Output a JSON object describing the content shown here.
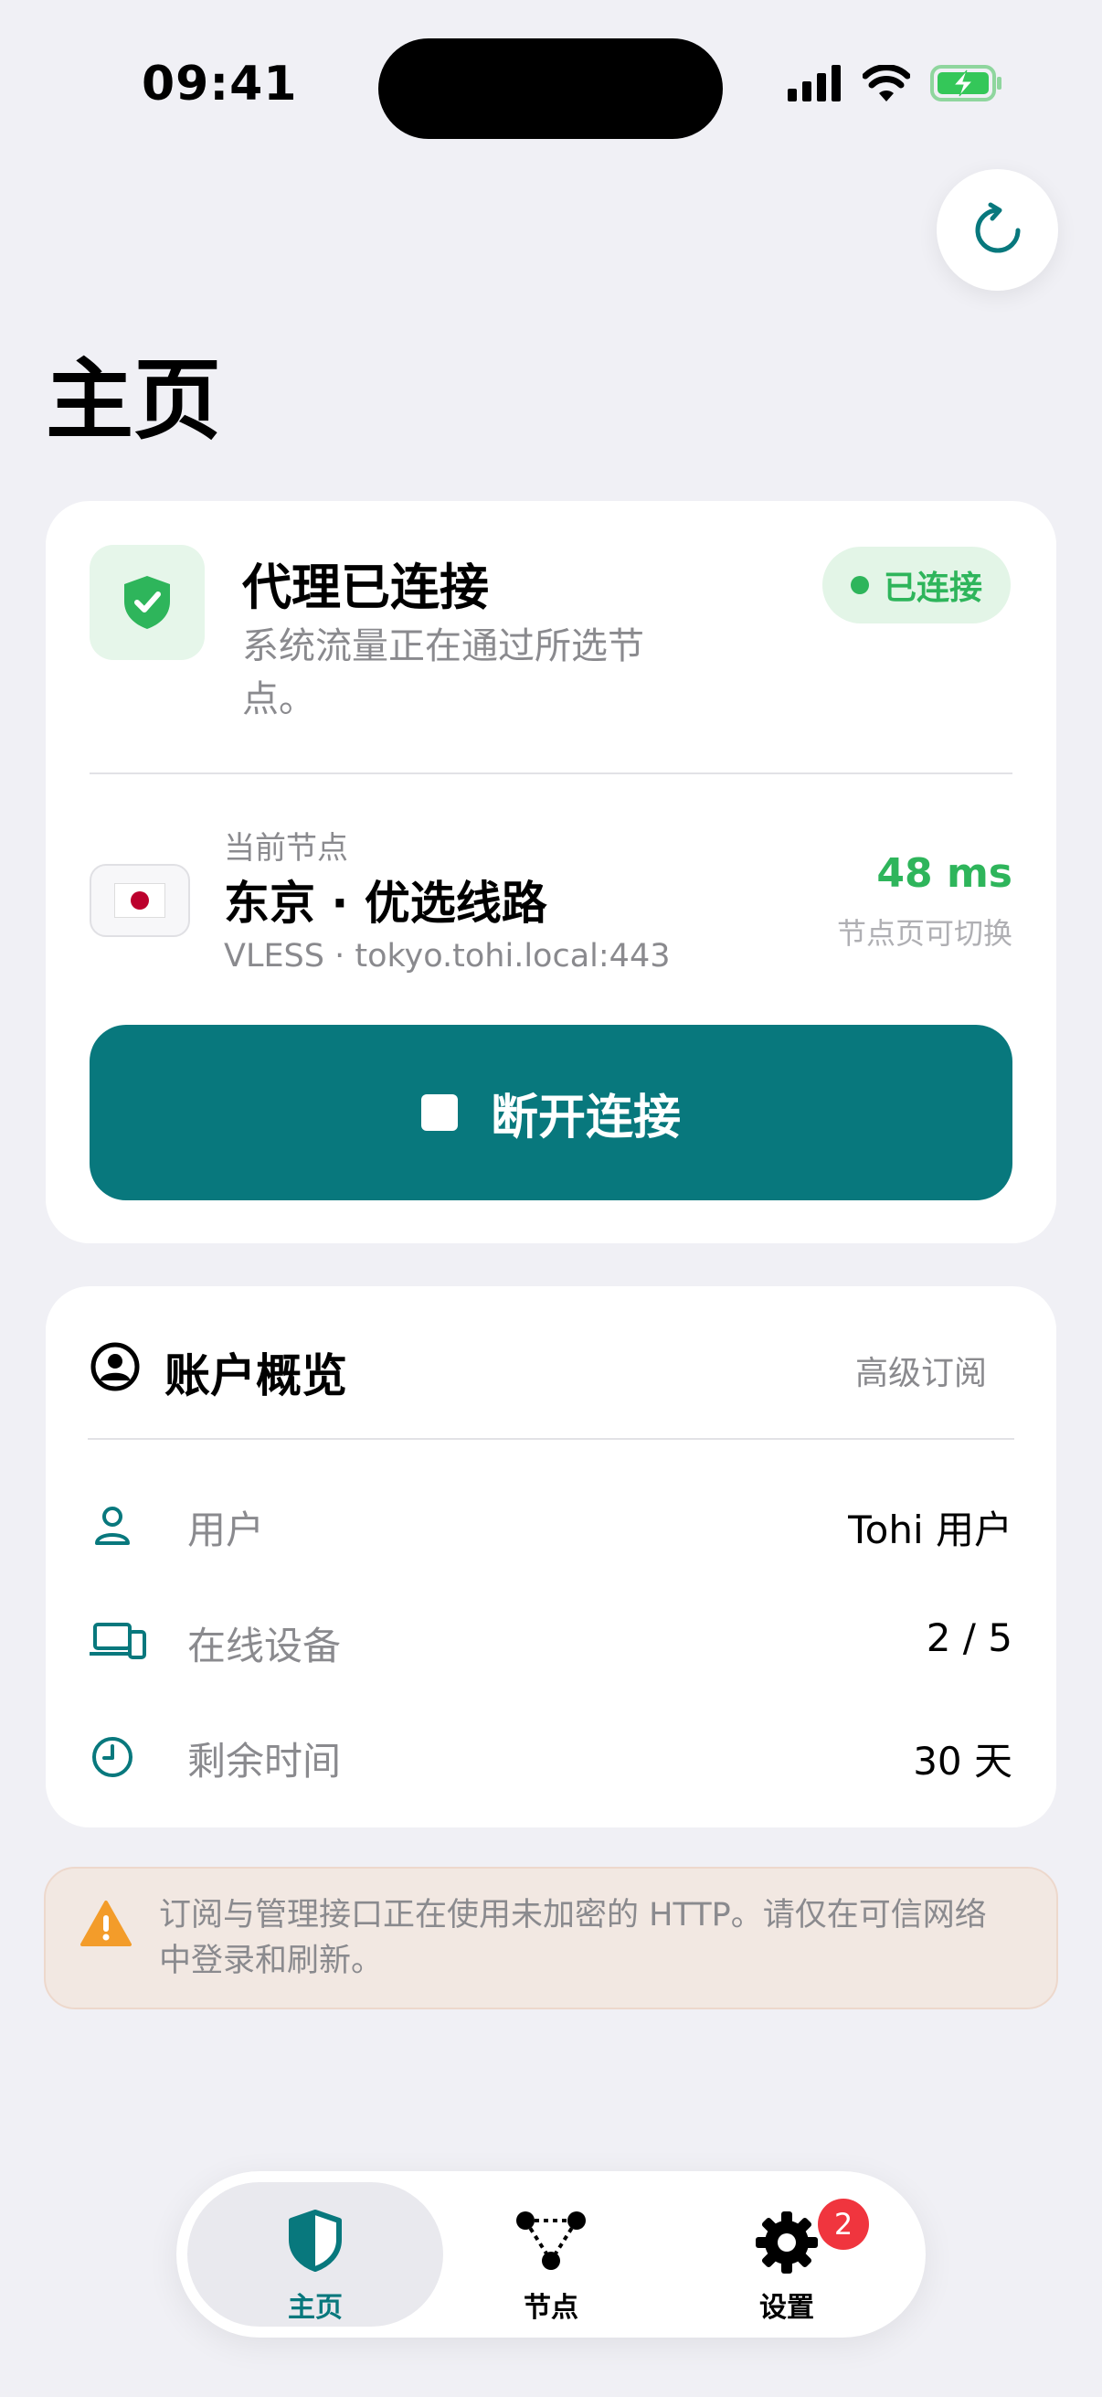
{
  "status_bar": {
    "time": "09:41"
  },
  "header": {
    "title": "主页"
  },
  "connection": {
    "title": "代理已连接",
    "subtitle": "系统流量正在通过所选节点。",
    "status": "已连接",
    "node_label": "当前节点",
    "node_name": "东京 · 优选线路",
    "node_address": "VLESS · tokyo.tohi.local:443",
    "latency": "48 ms",
    "switch_hint": "节点页可切换",
    "disconnect_label": "断开连接"
  },
  "account": {
    "title": "账户概览",
    "tier": "高级订阅",
    "rows": [
      {
        "label": "用户",
        "value": "Tohi 用户",
        "icon": "user-icon"
      },
      {
        "label": "在线设备",
        "value": "2 / 5",
        "icon": "devices-icon"
      },
      {
        "label": "剩余时间",
        "value": "30 天",
        "icon": "clock-icon"
      }
    ]
  },
  "warning": {
    "text": "订阅与管理接口正在使用未加密的 HTTP。请仅在可信网络中登录和刷新。"
  },
  "tabbar": {
    "tabs": [
      {
        "label": "主页",
        "icon": "shield-icon",
        "active": true
      },
      {
        "label": "节点",
        "icon": "nodes-icon",
        "active": false
      },
      {
        "label": "设置",
        "icon": "gear-icon",
        "active": false,
        "badge": "2"
      }
    ]
  },
  "colors": {
    "accent": "#08787D",
    "success": "#2EB55B",
    "warning": "#F39C2A",
    "badge": "#F0353E",
    "background": "#F0F0F5"
  }
}
